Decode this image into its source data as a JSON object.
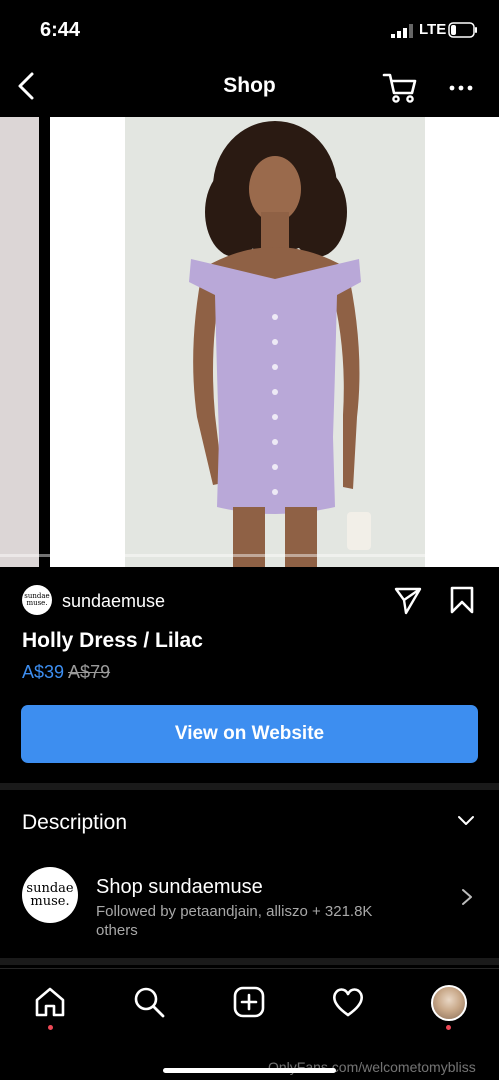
{
  "status_bar": {
    "time": "6:44",
    "network": "LTE"
  },
  "nav": {
    "title": "Shop",
    "back_icon": "chevron-left-icon",
    "cart_icon": "cart-icon",
    "more_icon": "ellipsis-icon"
  },
  "product": {
    "merchant": "sundaemuse",
    "merchant_logo_text": "sundae muse.",
    "name": "Holly Dress / Lilac",
    "sale_price": "A$39",
    "original_price": "A$79",
    "cta_label": "View on Website"
  },
  "description": {
    "label": "Description"
  },
  "shop": {
    "title": "Shop sundaemuse",
    "subtitle": "Followed by petaandjain, alliszo + 321.8K others",
    "logo_text": "sundae muse."
  },
  "tabbar": {
    "items": [
      "home-icon",
      "search-icon",
      "add-icon",
      "heart-icon",
      "profile-avatar"
    ]
  },
  "watermark": "OnlyFans.com/welcometomybliss",
  "colors": {
    "accent": "#3d8ef0",
    "notification": "#ed4956",
    "background": "#000000"
  }
}
